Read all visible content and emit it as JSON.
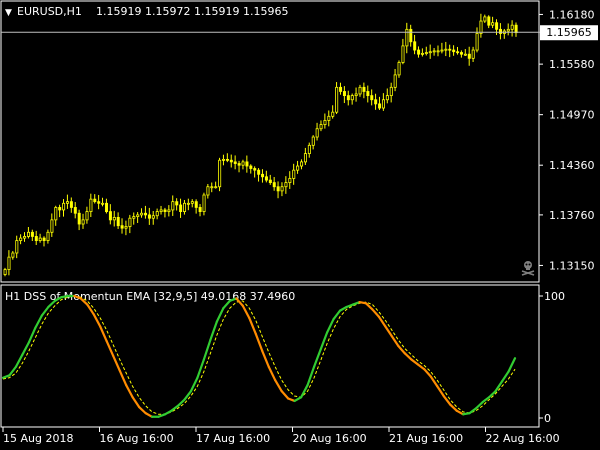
{
  "colors": {
    "background": "#000000",
    "frame": "#ffffff",
    "candle": "#ffff00",
    "current_price_line": "#c0c0c0",
    "osc_up": "#32cd32",
    "osc_down": "#ff8c00",
    "signal": "#ffff00",
    "text": "#ffffff"
  },
  "icons": {
    "skull_mark": "skull-icon"
  },
  "chart_data": [
    {
      "type": "candlestick",
      "title": "EURUSD,H1",
      "ohlc_header": "1.15919 1.15972 1.15919 1.15965",
      "title_marker": "▼",
      "ylim": [
        1.1295,
        1.1633
      ],
      "y_ticks": [
        1.1618,
        1.1558,
        1.1497,
        1.1436,
        1.1376,
        1.1315
      ],
      "y_tick_labels": [
        "1.16180",
        "1.15580",
        "1.14970",
        "1.14360",
        "1.13760",
        "1.13150"
      ],
      "current_price": 1.15965,
      "current_price_label": "1.15965",
      "series": [
        {
          "values": [
            1.131,
            1.1325,
            1.133,
            1.1345,
            1.1348,
            1.135,
            1.1355,
            1.135,
            1.1345,
            1.1348,
            1.1345,
            1.1355,
            1.137,
            1.1385,
            1.1382,
            1.139,
            1.1392,
            1.1385,
            1.1378,
            1.1365,
            1.137,
            1.138,
            1.1395,
            1.1392,
            1.139,
            1.139,
            1.138,
            1.137,
            1.1373,
            1.1363,
            1.136,
            1.1362,
            1.1372,
            1.1374,
            1.1376,
            1.1378,
            1.1376,
            1.1372,
            1.1375,
            1.138,
            1.1382,
            1.138,
            1.1382,
            1.1392,
            1.1388,
            1.138,
            1.139,
            1.139,
            1.1392,
            1.1385,
            1.138,
            1.14,
            1.141,
            1.141,
            1.141,
            1.1442,
            1.1443,
            1.1442,
            1.144,
            1.1438,
            1.1436,
            1.144,
            1.1435,
            1.1432,
            1.143,
            1.1425,
            1.1422,
            1.1418,
            1.1415,
            1.141,
            1.1405,
            1.141,
            1.1415,
            1.142,
            1.143,
            1.1435,
            1.144,
            1.145,
            1.146,
            1.147,
            1.148,
            1.1485,
            1.149,
            1.1495,
            1.15,
            1.153,
            1.1525,
            1.152,
            1.1515,
            1.152,
            1.1522,
            1.153,
            1.1525,
            1.152,
            1.1515,
            1.151,
            1.1505,
            1.1515,
            1.152,
            1.153,
            1.1545,
            1.156,
            1.158,
            1.16,
            1.1585,
            1.1575,
            1.157,
            1.1571,
            1.1572,
            1.1573,
            1.1574,
            1.1574,
            1.1575,
            1.1576,
            1.1575,
            1.1573,
            1.1572,
            1.157,
            1.157,
            1.1565,
            1.1575,
            1.1595,
            1.161,
            1.1615,
            1.1605,
            1.1608,
            1.16,
            1.1595,
            1.1598,
            1.16,
            1.1605,
            1.1596
          ]
        }
      ]
    },
    {
      "type": "line",
      "title": "H1 DSS of Momentun EMA [32,9,5] 49.0168 37.4960",
      "ylim": [
        0,
        100
      ],
      "y_ticks": [
        0,
        100
      ],
      "y_tick_labels": [
        "0",
        "100"
      ],
      "categories": [
        "15 Aug 2018",
        "16 Aug 16:00",
        "17 Aug 16:00",
        "20 Aug 16:00",
        "21 Aug 16:00",
        "22 Aug 16:00"
      ],
      "series": [
        {
          "values": [
            33,
            35,
            42,
            52,
            62,
            74,
            84,
            91,
            96,
            99,
            100,
            100,
            98,
            93,
            85,
            75,
            63,
            51,
            39,
            27,
            17,
            9,
            4,
            1,
            1,
            3,
            6,
            10,
            15,
            22,
            33,
            48,
            64,
            79,
            90,
            96,
            98,
            92,
            82,
            69,
            55,
            42,
            31,
            22,
            16,
            14,
            17,
            27,
            42,
            56,
            70,
            81,
            88,
            91,
            93,
            95,
            94,
            89,
            83,
            75,
            67,
            59,
            53,
            48,
            44,
            40,
            34,
            26,
            18,
            11,
            6,
            3,
            4,
            8,
            13,
            17,
            22,
            30,
            38,
            49
          ]
        },
        {
          "values": [
            32,
            33,
            37,
            45,
            55,
            66,
            77,
            86,
            92,
            97,
            99,
            100,
            99,
            96,
            90,
            82,
            72,
            60,
            48,
            37,
            26,
            17,
            10,
            5,
            3,
            3,
            5,
            8,
            12,
            18,
            26,
            38,
            53,
            68,
            81,
            90,
            95,
            96,
            90,
            80,
            67,
            54,
            42,
            31,
            23,
            18,
            17,
            22,
            33,
            47,
            61,
            73,
            83,
            89,
            92,
            94,
            95,
            93,
            87,
            80,
            72,
            64,
            57,
            52,
            47,
            43,
            38,
            31,
            23,
            15,
            9,
            5,
            4,
            6,
            10,
            15,
            20,
            26,
            32,
            40
          ]
        }
      ]
    }
  ]
}
